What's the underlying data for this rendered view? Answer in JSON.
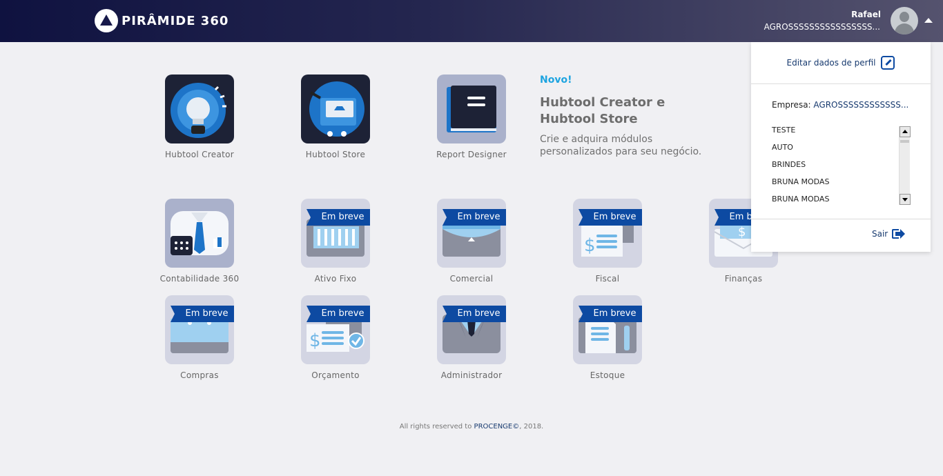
{
  "header": {
    "logo_text": "PIRÂMIDE 360",
    "user_name": "Rafael",
    "user_company": "AGROSSSSSSSSSSSSSSSS..."
  },
  "featured": [
    {
      "label": "Hubtool Creator",
      "icon": "lightbulb-icon"
    },
    {
      "label": "Hubtool Store",
      "icon": "store-cart-icon"
    },
    {
      "label": "Report Designer",
      "icon": "book-icon"
    }
  ],
  "promo": {
    "badge": "Novo!",
    "title": "Hubtool Creator e Hubtool Store",
    "description": "Crie e adquira módulos personalizados para seu negócio."
  },
  "modules": [
    {
      "label": "Contabilidade 360",
      "badge": "",
      "icon": "accountant-icon"
    },
    {
      "label": "Ativo Fixo",
      "badge": "Em breve",
      "icon": "fixed-asset-icon"
    },
    {
      "label": "Comercial",
      "badge": "Em breve",
      "icon": "briefcase-icon"
    },
    {
      "label": "Fiscal",
      "badge": "Em breve",
      "icon": "tax-document-icon"
    },
    {
      "label": "Finanças",
      "badge": "Em breve",
      "icon": "money-envelope-icon"
    },
    {
      "label": "Compras",
      "badge": "Em breve",
      "icon": "purchase-icon"
    },
    {
      "label": "Orçamento",
      "badge": "Em breve",
      "icon": "budget-icon"
    },
    {
      "label": "Administrador",
      "badge": "Em breve",
      "icon": "admin-suit-icon"
    },
    {
      "label": "Estoque",
      "badge": "Em breve",
      "icon": "inventory-icon"
    }
  ],
  "dropdown": {
    "edit_profile": "Editar dados de perfil",
    "company_label": "Empresa:",
    "company_value": "AGROSSSSSSSSSSSS...",
    "companies": [
      "TESTE",
      "AUTO",
      "BRINDES",
      "BRUNA MODAS",
      "BRUNA MODAS"
    ],
    "logout": "Sair"
  },
  "footer": {
    "prefix": "All rights reserved to",
    "brand": "PROCENGE©",
    "suffix": ", 2018."
  }
}
